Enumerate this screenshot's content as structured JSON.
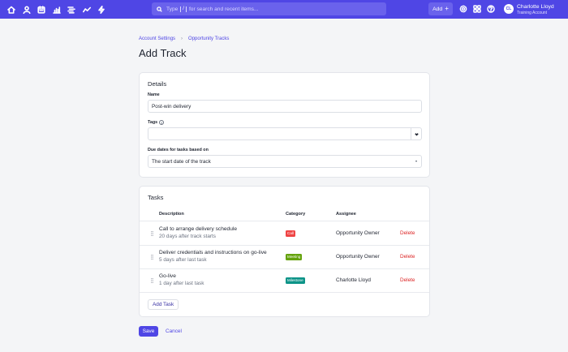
{
  "topbar": {
    "nav_icons": [
      "home-icon",
      "user-icon",
      "calendar-icon",
      "chart-bar-icon",
      "list-icon",
      "trend-line-icon",
      "lightning-icon"
    ],
    "search": {
      "prefix": "Type",
      "key": "/",
      "suffix": "for search and recent items..."
    },
    "add_label": "Add",
    "add_plus": "+",
    "right_icons": [
      "settings-icon",
      "apps-grid-icon",
      "help-icon"
    ],
    "user": {
      "initials": "CL",
      "name": "Charlotte Lloyd",
      "account": "Training Account"
    }
  },
  "breadcrumb": {
    "items": [
      "Account Settings",
      "Opportunity Tracks"
    ],
    "separator": "›"
  },
  "page_title": "Add Track",
  "details": {
    "title": "Details",
    "name_label": "Name",
    "name_value": "Post-win delivery",
    "tags_label": "Tags",
    "tags_value": "",
    "due_label": "Due dates for tasks based on",
    "due_value": "The start date of the track"
  },
  "tasks": {
    "title": "Tasks",
    "columns": {
      "description": "Description",
      "category": "Category",
      "assignee": "Assignee"
    },
    "rows": [
      {
        "title": "Call to arrange delivery schedule",
        "subtitle": "20 days after track starts",
        "category": "Call",
        "category_color": "#ef4444",
        "assignee": "Opportunity Owner",
        "action": "Delete"
      },
      {
        "title": "Deliver credentials and instructions on go-live",
        "subtitle": "5 days after last task",
        "category": "Meeting",
        "category_color": "#65a30d",
        "assignee": "Opportunity Owner",
        "action": "Delete"
      },
      {
        "title": "Go-live",
        "subtitle": "1 day after last task",
        "category": "Milestone",
        "category_color": "#0d9488",
        "assignee": "Charlotte Lloyd",
        "action": "Delete"
      }
    ],
    "add_task_label": "Add Task"
  },
  "footer": {
    "save_label": "Save",
    "cancel_label": "Cancel"
  },
  "colors": {
    "primary": "#4f46e5",
    "danger": "#dc2626"
  }
}
